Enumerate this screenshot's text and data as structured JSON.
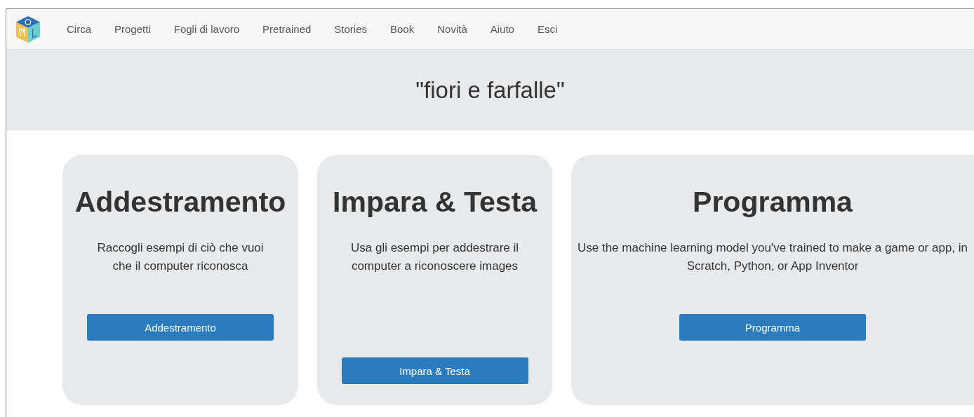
{
  "nav": {
    "items": [
      "Circa",
      "Progetti",
      "Fogli di lavoro",
      "Pretrained",
      "Stories",
      "Book",
      "Novità",
      "Aiuto",
      "Esci"
    ]
  },
  "header": {
    "title": "\"fiori e farfalle\""
  },
  "cards": [
    {
      "title": "Addestramento",
      "description": "Raccogli esempi di ciò che vuoi che il computer riconosca",
      "button": "Addestramento"
    },
    {
      "title": "Impara & Testa",
      "description": "Usa gli esempi per addestrare il computer a riconoscere images",
      "button": "Impara & Testa"
    },
    {
      "title": "Programma",
      "description": "Use the machine learning model you've trained to make a game or app, in Scratch, Python, or App Inventor",
      "button": "Programma"
    }
  ]
}
